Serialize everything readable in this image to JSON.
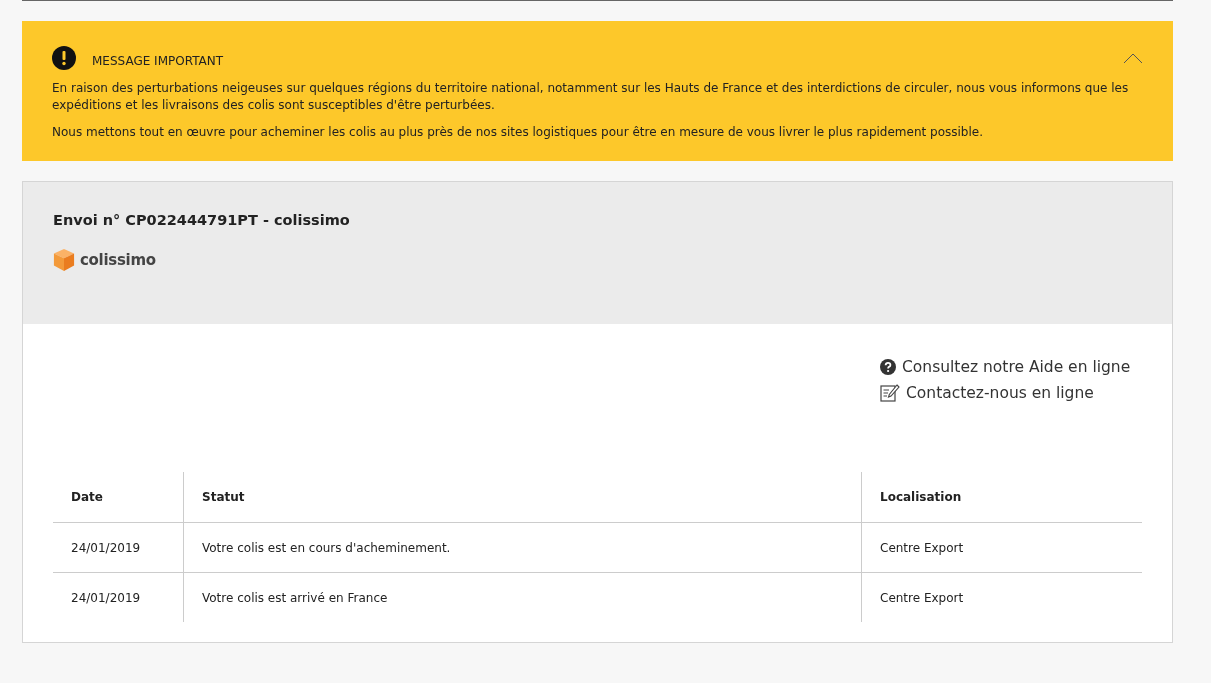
{
  "notice": {
    "title": "MESSAGE IMPORTANT",
    "expanded": true,
    "paragraphs": [
      "En raison des perturbations neigeuses sur quelques régions du territoire national, notamment sur les Hauts de France et des interdictions de circuler, nous vous informons que les expéditions et les livraisons des colis sont susceptibles d'être perturbées.",
      "Nous mettons tout en œuvre pour acheminer les colis au plus près de nos sites logistiques pour être en mesure de vous livrer le plus rapidement possible."
    ]
  },
  "shipment": {
    "title": "Envoi n° CP022444791PT - colissimo",
    "carrier": "colissimo"
  },
  "help_links": [
    {
      "kind": "help",
      "label": "Consultez notre Aide en ligne"
    },
    {
      "kind": "contact",
      "label": "Contactez-nous en ligne"
    }
  ],
  "table": {
    "columns": [
      "Date",
      "Statut",
      "Localisation"
    ],
    "rows": [
      [
        "24/01/2019",
        "Votre colis est en cours d'acheminement.",
        "Centre Export"
      ],
      [
        "24/01/2019",
        "Votre colis est arrivé en France",
        "Centre Export"
      ]
    ]
  }
}
